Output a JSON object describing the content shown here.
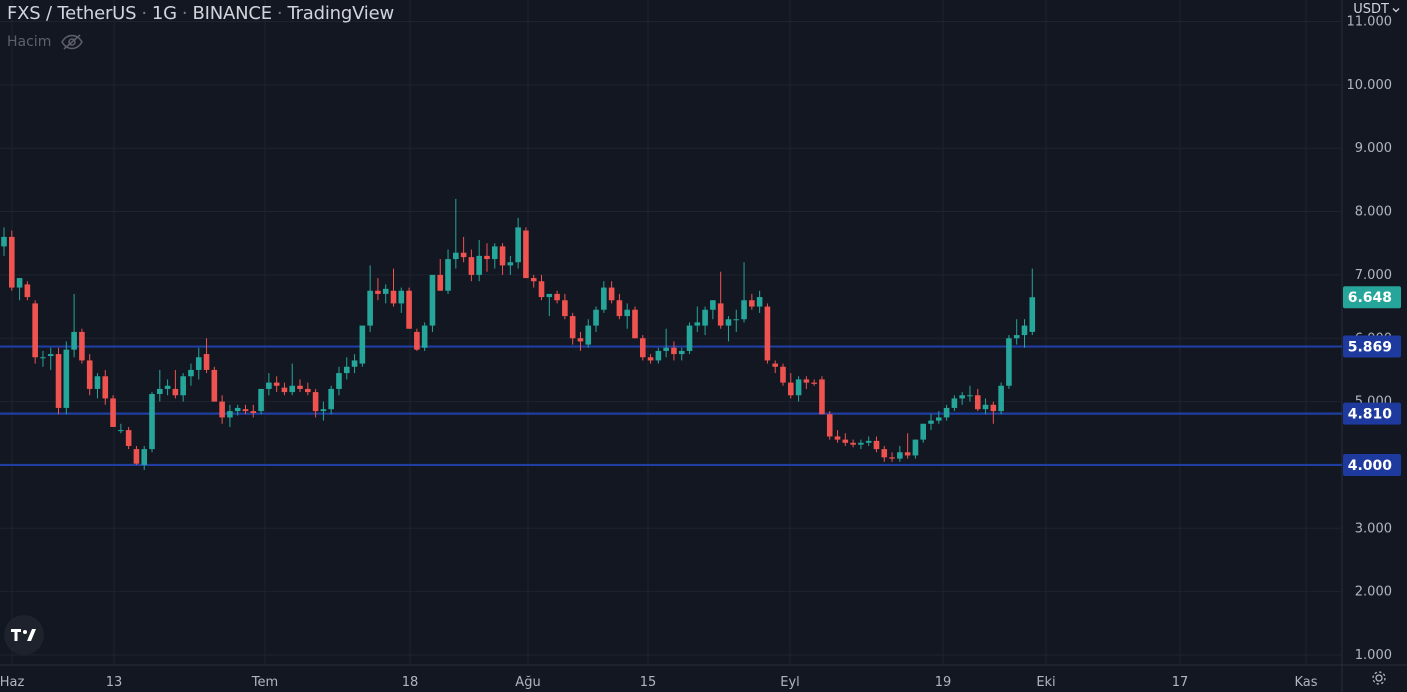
{
  "header": {
    "symbol": "FXS / TetherUS",
    "interval": "1G",
    "exchange": "BINANCE",
    "provider": "TradingView",
    "volume_label": "Hacim",
    "volume_icon": "eye-off-icon"
  },
  "currency_selector": {
    "label": "USDT"
  },
  "colors": {
    "background": "#131722",
    "grid": "#1f2330",
    "up": "#26a69a",
    "down": "#ef5350",
    "hline": "#1f3ea1",
    "hline_label": "#1e3a9e",
    "last_price_label": "#26a69a",
    "axis_text": "#b2b5be"
  },
  "chart_data": {
    "type": "candlestick",
    "ylim": [
      0.85,
      11.1
    ],
    "y_ticks": [
      "1.000",
      "2.000",
      "3.000",
      "4.000",
      "5.000",
      "6.000",
      "7.000",
      "8.000",
      "9.000",
      "10.000",
      "11.000"
    ],
    "x_labels": [
      "Haz",
      "13",
      "Tem",
      "18",
      "Ağu",
      "15",
      "Eyl",
      "19",
      "Eki",
      "17",
      "Kas"
    ],
    "horizontal_lines": [
      5.869,
      4.81,
      4.0
    ],
    "last_price": 6.648,
    "price_labels": [
      "5.869",
      "4.810",
      "4.000",
      "6.648"
    ],
    "ohlc": [
      [
        7.45,
        7.75,
        7.3,
        7.6
      ],
      [
        7.6,
        7.7,
        6.75,
        6.8
      ],
      [
        6.8,
        6.95,
        6.6,
        6.95
      ],
      [
        6.85,
        6.9,
        6.6,
        6.65
      ],
      [
        6.55,
        6.6,
        5.6,
        5.7
      ],
      [
        5.7,
        5.8,
        5.55,
        5.7
      ],
      [
        5.72,
        5.85,
        5.5,
        5.75
      ],
      [
        5.75,
        5.85,
        4.8,
        4.9
      ],
      [
        4.9,
        5.95,
        4.8,
        5.82
      ],
      [
        5.82,
        6.7,
        5.7,
        6.1
      ],
      [
        6.1,
        6.15,
        5.6,
        5.65
      ],
      [
        5.65,
        5.75,
        5.1,
        5.2
      ],
      [
        5.2,
        5.45,
        5.05,
        5.4
      ],
      [
        5.4,
        5.5,
        4.95,
        5.05
      ],
      [
        5.05,
        5.1,
        4.6,
        4.6
      ],
      [
        4.55,
        4.65,
        4.5,
        4.55
      ],
      [
        4.55,
        4.6,
        4.25,
        4.3
      ],
      [
        4.25,
        4.3,
        4.0,
        4.02
      ],
      [
        4.0,
        4.3,
        3.92,
        4.25
      ],
      [
        4.25,
        5.15,
        4.2,
        5.12
      ],
      [
        5.12,
        5.5,
        5.0,
        5.2
      ],
      [
        5.2,
        5.35,
        5.1,
        5.25
      ],
      [
        5.2,
        5.5,
        5.05,
        5.1
      ],
      [
        5.1,
        5.45,
        5.0,
        5.4
      ],
      [
        5.4,
        5.6,
        5.25,
        5.5
      ],
      [
        5.5,
        5.85,
        5.35,
        5.7
      ],
      [
        5.75,
        6.0,
        5.45,
        5.5
      ],
      [
        5.5,
        5.55,
        5.0,
        5.0
      ],
      [
        5.0,
        5.1,
        4.65,
        4.75
      ],
      [
        4.75,
        4.95,
        4.6,
        4.85
      ],
      [
        4.85,
        4.95,
        4.78,
        4.9
      ],
      [
        4.88,
        4.95,
        4.8,
        4.85
      ],
      [
        4.85,
        4.95,
        4.75,
        4.82
      ],
      [
        4.85,
        5.2,
        4.8,
        5.2
      ],
      [
        5.2,
        5.45,
        5.1,
        5.3
      ],
      [
        5.3,
        5.4,
        5.15,
        5.25
      ],
      [
        5.22,
        5.3,
        5.1,
        5.15
      ],
      [
        5.15,
        5.6,
        5.1,
        5.25
      ],
      [
        5.25,
        5.35,
        5.15,
        5.2
      ],
      [
        5.2,
        5.3,
        5.1,
        5.15
      ],
      [
        5.15,
        5.2,
        4.75,
        4.85
      ],
      [
        4.85,
        5.0,
        4.7,
        4.88
      ],
      [
        4.88,
        5.25,
        4.8,
        5.2
      ],
      [
        5.2,
        5.55,
        5.1,
        5.45
      ],
      [
        5.45,
        5.7,
        5.35,
        5.55
      ],
      [
        5.55,
        5.75,
        5.45,
        5.65
      ],
      [
        5.6,
        6.2,
        5.55,
        6.2
      ],
      [
        6.2,
        7.15,
        6.1,
        6.75
      ],
      [
        6.75,
        6.95,
        6.6,
        6.7
      ],
      [
        6.7,
        6.85,
        6.55,
        6.78
      ],
      [
        6.75,
        7.1,
        6.5,
        6.55
      ],
      [
        6.55,
        6.8,
        6.4,
        6.75
      ],
      [
        6.75,
        6.8,
        6.15,
        6.15
      ],
      [
        6.1,
        6.15,
        5.8,
        5.82
      ],
      [
        5.85,
        6.25,
        5.8,
        6.2
      ],
      [
        6.2,
        7.0,
        6.1,
        7.0
      ],
      [
        7.0,
        7.25,
        6.75,
        6.75
      ],
      [
        6.75,
        7.4,
        6.7,
        7.25
      ],
      [
        7.25,
        8.2,
        7.1,
        7.35
      ],
      [
        7.35,
        7.6,
        7.2,
        7.28
      ],
      [
        7.28,
        7.4,
        6.9,
        7.0
      ],
      [
        7.0,
        7.55,
        6.9,
        7.3
      ],
      [
        7.3,
        7.5,
        7.05,
        7.25
      ],
      [
        7.25,
        7.5,
        7.1,
        7.45
      ],
      [
        7.45,
        7.5,
        7.0,
        7.15
      ],
      [
        7.15,
        7.3,
        7.0,
        7.2
      ],
      [
        7.2,
        7.9,
        7.1,
        7.75
      ],
      [
        7.7,
        7.75,
        6.95,
        6.95
      ],
      [
        6.95,
        7.0,
        6.8,
        6.9
      ],
      [
        6.9,
        7.0,
        6.6,
        6.65
      ],
      [
        6.65,
        6.7,
        6.35,
        6.7
      ],
      [
        6.7,
        6.75,
        6.55,
        6.6
      ],
      [
        6.6,
        6.7,
        6.3,
        6.35
      ],
      [
        6.35,
        6.4,
        5.9,
        6.0
      ],
      [
        6.0,
        6.1,
        5.8,
        5.95
      ],
      [
        5.9,
        6.3,
        5.85,
        6.2
      ],
      [
        6.2,
        6.5,
        6.1,
        6.45
      ],
      [
        6.45,
        6.9,
        6.4,
        6.8
      ],
      [
        6.8,
        6.9,
        6.55,
        6.6
      ],
      [
        6.6,
        6.7,
        6.3,
        6.35
      ],
      [
        6.35,
        6.55,
        6.15,
        6.45
      ],
      [
        6.45,
        6.5,
        6.0,
        6.0
      ],
      [
        6.0,
        6.05,
        5.65,
        5.7
      ],
      [
        5.7,
        5.75,
        5.6,
        5.65
      ],
      [
        5.65,
        5.85,
        5.6,
        5.8
      ],
      [
        5.8,
        6.15,
        5.7,
        5.85
      ],
      [
        5.85,
        5.95,
        5.65,
        5.75
      ],
      [
        5.75,
        5.85,
        5.65,
        5.8
      ],
      [
        5.8,
        6.25,
        5.75,
        6.2
      ],
      [
        6.2,
        6.5,
        6.1,
        6.25
      ],
      [
        6.2,
        6.5,
        6.05,
        6.45
      ],
      [
        6.45,
        6.6,
        6.3,
        6.6
      ],
      [
        6.55,
        7.05,
        6.15,
        6.2
      ],
      [
        6.2,
        6.35,
        5.95,
        6.3
      ],
      [
        6.3,
        6.45,
        6.1,
        6.3
      ],
      [
        6.3,
        7.2,
        6.25,
        6.6
      ],
      [
        6.6,
        6.7,
        6.45,
        6.5
      ],
      [
        6.5,
        6.75,
        6.4,
        6.65
      ],
      [
        6.5,
        6.55,
        5.6,
        5.65
      ],
      [
        5.6,
        5.65,
        5.45,
        5.55
      ],
      [
        5.55,
        5.6,
        5.25,
        5.3
      ],
      [
        5.3,
        5.45,
        5.05,
        5.1
      ],
      [
        5.1,
        5.4,
        5.0,
        5.35
      ],
      [
        5.35,
        5.4,
        5.2,
        5.3
      ],
      [
        5.3,
        5.35,
        5.25,
        5.28
      ],
      [
        5.35,
        5.4,
        4.8,
        4.8
      ],
      [
        4.8,
        4.85,
        4.4,
        4.45
      ],
      [
        4.45,
        4.55,
        4.35,
        4.4
      ],
      [
        4.4,
        4.5,
        4.3,
        4.35
      ],
      [
        4.35,
        4.4,
        4.28,
        4.32
      ],
      [
        4.32,
        4.4,
        4.25,
        4.35
      ],
      [
        4.35,
        4.45,
        4.3,
        4.38
      ],
      [
        4.38,
        4.45,
        4.2,
        4.25
      ],
      [
        4.25,
        4.3,
        4.05,
        4.12
      ],
      [
        4.12,
        4.2,
        4.05,
        4.1
      ],
      [
        4.1,
        4.3,
        4.05,
        4.2
      ],
      [
        4.2,
        4.5,
        4.1,
        4.15
      ],
      [
        4.15,
        4.4,
        4.1,
        4.4
      ],
      [
        4.4,
        4.65,
        4.35,
        4.65
      ],
      [
        4.65,
        4.8,
        4.55,
        4.7
      ],
      [
        4.7,
        4.85,
        4.65,
        4.75
      ],
      [
        4.75,
        4.95,
        4.7,
        4.9
      ],
      [
        4.9,
        5.1,
        4.85,
        5.05
      ],
      [
        5.05,
        5.15,
        4.95,
        5.1
      ],
      [
        5.1,
        5.25,
        5.0,
        5.1
      ],
      [
        5.1,
        5.2,
        4.85,
        4.88
      ],
      [
        4.88,
        5.05,
        4.8,
        4.95
      ],
      [
        4.95,
        5.0,
        4.65,
        4.85
      ],
      [
        4.85,
        5.3,
        4.8,
        5.25
      ],
      [
        5.25,
        6.05,
        5.2,
        6.0
      ],
      [
        6.0,
        6.3,
        5.9,
        6.05
      ],
      [
        6.05,
        6.3,
        5.85,
        6.2
      ],
      [
        6.1,
        7.1,
        6.05,
        6.648
      ]
    ]
  }
}
